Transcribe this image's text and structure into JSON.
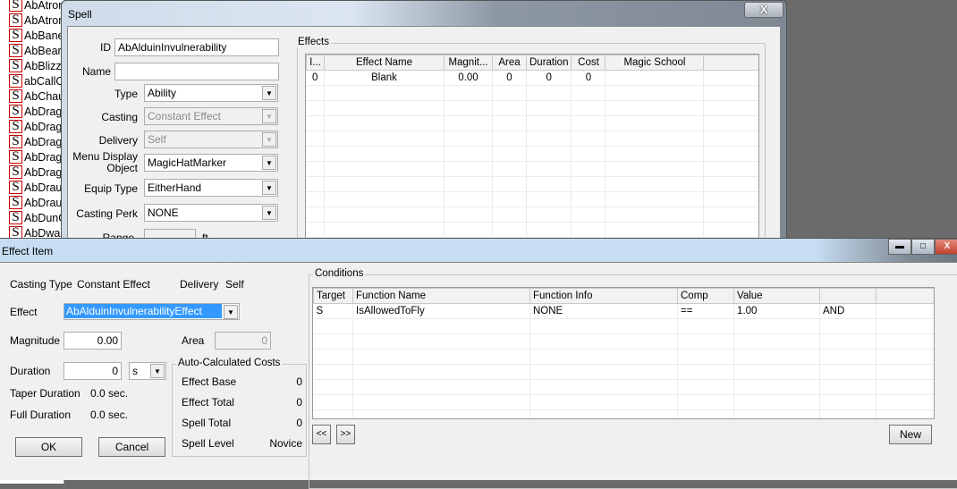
{
  "object_list": {
    "items": [
      "AbAtron",
      "AbAtron",
      "AbBane",
      "AbBearS",
      "AbBlizza",
      "abCallO",
      "AbChau",
      "AbDrag",
      "AbDrag",
      "AbDrag",
      "AbDrag",
      "AbDrag",
      "AbDraug",
      "AbDraug",
      "AbDunG",
      "AbDwar"
    ],
    "icon_letter": "S"
  },
  "spell": {
    "title": "Spell",
    "close": "X",
    "id_label": "ID",
    "id_value": "AbAlduinInvulnerability",
    "name_label": "Name",
    "name_value": "",
    "type_label": "Type",
    "type_value": "Ability",
    "casting_label": "Casting",
    "casting_value": "Constant Effect",
    "delivery_label": "Delivery",
    "delivery_value": "Self",
    "menu_label_1": "Menu Display",
    "menu_label_2": "Object",
    "menu_value": "MagicHatMarker",
    "equip_label": "Equip Type",
    "equip_value": "EitherHand",
    "perk_label": "Casting Perk",
    "perk_value": "NONE",
    "range_label": "Range",
    "range_unit": "ft",
    "effects": {
      "title": "Effects",
      "columns": [
        "I...",
        "Effect Name",
        "Magnit...",
        "Area",
        "Duration",
        "Cost",
        "Magic School"
      ],
      "rows": [
        [
          "0",
          "Blank",
          "0.00",
          "0",
          "0",
          "0",
          ""
        ]
      ]
    }
  },
  "effect_item": {
    "title": "Effect Item",
    "casting_type_label": "Casting Type",
    "casting_type_value": "Constant Effect",
    "delivery_label": "Delivery",
    "delivery_value": "Self",
    "effect_label": "Effect",
    "effect_value": "AbAlduinInvulnerabilityEffect",
    "magnitude_label": "Magnitude",
    "magnitude_value": "0.00",
    "area_label": "Area",
    "area_value": "0",
    "duration_label": "Duration",
    "duration_value": "0",
    "duration_unit": "s",
    "taper_label": "Taper Duration",
    "taper_value": "0.0 sec.",
    "full_label": "Full Duration",
    "full_value": "0.0 sec.",
    "ok": "OK",
    "cancel": "Cancel",
    "costs": {
      "title": "Auto-Calculated Costs",
      "rows": [
        [
          "Effect Base",
          "0"
        ],
        [
          "Effect Total",
          "0"
        ],
        [
          "Spell Total",
          "0"
        ],
        [
          "Spell Level",
          "Novice"
        ]
      ]
    },
    "conditions": {
      "title": "Conditions",
      "columns": [
        "Target",
        "Function Name",
        "Function Info",
        "Comp",
        "Value",
        ""
      ],
      "rows": [
        [
          "S",
          "IsAllowedToFly",
          "NONE",
          "==",
          "1.00",
          "AND"
        ]
      ]
    },
    "prev": "<<",
    "next": ">>",
    "new": "New"
  }
}
